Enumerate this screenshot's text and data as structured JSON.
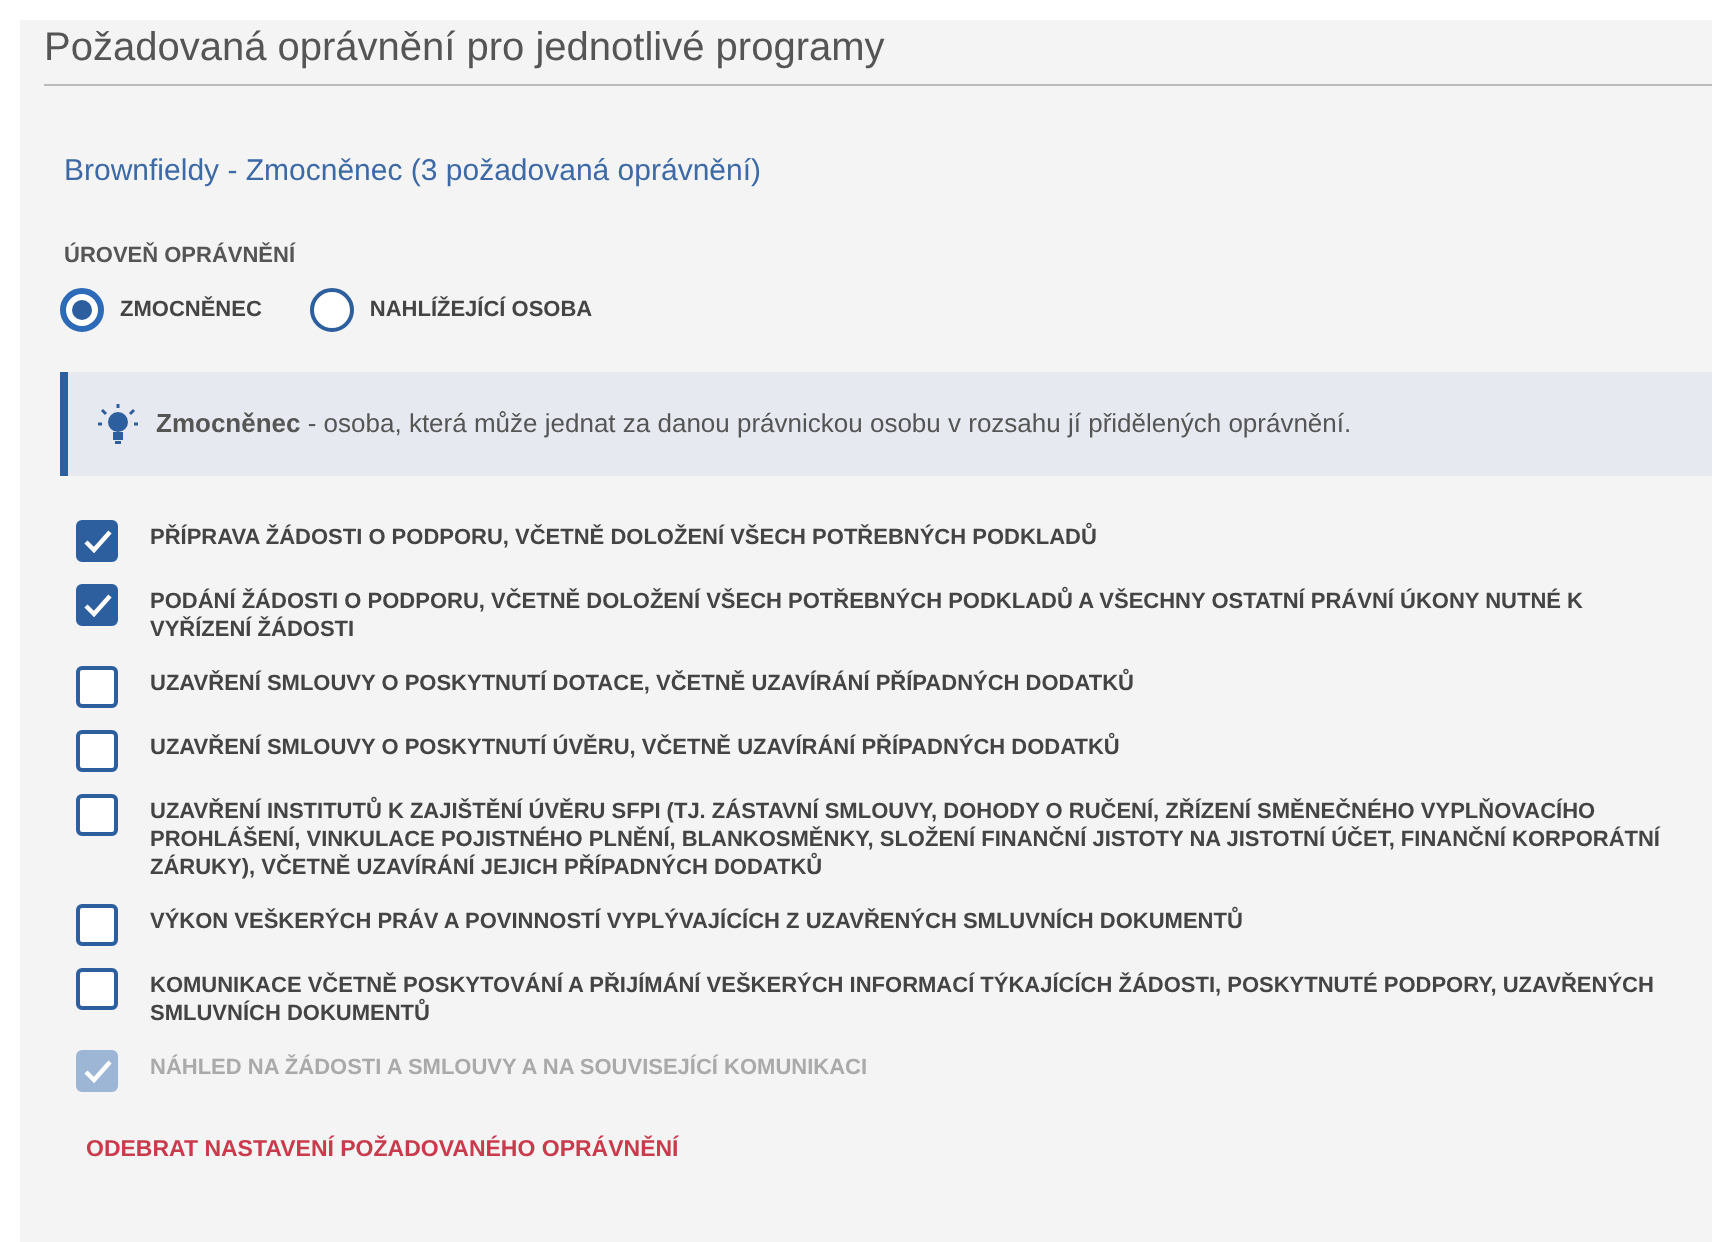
{
  "title": "Požadovaná oprávnění pro jednotlivé programy",
  "program_heading": "Brownfieldy - Zmocněnec (3 požadovaná oprávnění)",
  "level_label": "ÚROVEŇ OPRÁVNĚNÍ",
  "levels": [
    {
      "label": "ZMOCNĚNEC",
      "selected": true
    },
    {
      "label": "NAHLÍŽEJÍCÍ OSOBA",
      "selected": false
    }
  ],
  "info": {
    "text": "**Zmocněnec** - osoba, která může jednat za danou právnickou osobu v rozsahu jí přidělených oprávnění."
  },
  "permissions": [
    {
      "label": "PŘÍPRAVA ŽÁDOSTI O PODPORU, VČETNĚ DOLOŽENÍ VŠECH POTŘEBNÝCH PODKLADŮ",
      "checked": true,
      "disabled": false
    },
    {
      "label": "PODÁNÍ ŽÁDOSTI O PODPORU, VČETNĚ DOLOŽENÍ VŠECH POTŘEBNÝCH PODKLADŮ A VŠECHNY OSTATNÍ PRÁVNÍ ÚKONY NUTNÉ K VYŘÍZENÍ ŽÁDOSTI",
      "checked": true,
      "disabled": false
    },
    {
      "label": "UZAVŘENÍ SMLOUVY O POSKYTNUTÍ DOTACE, VČETNĚ UZAVÍRÁNÍ PŘÍPADNÝCH DODATKŮ",
      "checked": false,
      "disabled": false
    },
    {
      "label": "UZAVŘENÍ SMLOUVY O POSKYTNUTÍ ÚVĚRU, VČETNĚ UZAVÍRÁNÍ PŘÍPADNÝCH DODATKŮ",
      "checked": false,
      "disabled": false
    },
    {
      "label": "UZAVŘENÍ INSTITUTŮ K ZAJIŠTĚNÍ ÚVĚRU SFPI (TJ. ZÁSTAVNÍ SMLOUVY, DOHODY O RUČENÍ, ZŘÍZENÍ SMĚNEČNÉHO VYPLŇOVACÍHO PROHLÁŠENÍ, VINKULACE POJISTNÉHO PLNĚNÍ, BLANKOSMĚNKY, SLOŽENÍ FINANČNÍ JISTOTY NA JISTOTNÍ ÚČET, FINANČNÍ KORPORÁTNÍ ZÁRUKY), VČETNĚ UZAVÍRÁNÍ JEJICH PŘÍPADNÝCH DODATKŮ",
      "checked": false,
      "disabled": false
    },
    {
      "label": "VÝKON VEŠKERÝCH PRÁV A POVINNOSTÍ VYPLÝVAJÍCÍCH Z UZAVŘENÝCH SMLUVNÍCH DOKUMENTŮ",
      "checked": false,
      "disabled": false
    },
    {
      "label": "KOMUNIKACE VČETNĚ POSKYTOVÁNÍ A PŘIJÍMÁNÍ VEŠKERÝCH INFORMACÍ TÝKAJÍCÍCH ŽÁDOSTI, POSKYTNUTÉ PODPORY, UZAVŘENÝCH SMLUVNÍCH DOKUMENTŮ",
      "checked": false,
      "disabled": false
    },
    {
      "label": "NÁHLED NA ŽÁDOSTI A SMLOUVY A NA SOUVISEJÍCÍ KOMUNIKACI",
      "checked": true,
      "disabled": true
    }
  ],
  "remove_link": "ODEBRAT NASTAVENÍ POŽADOVANÉHO OPRÁVNĚNÍ"
}
